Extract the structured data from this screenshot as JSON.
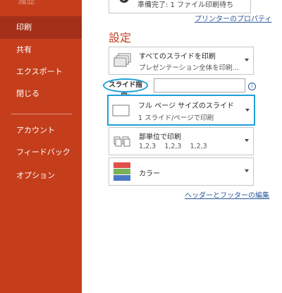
{
  "sidebar": {
    "top_partial": "履歴",
    "items": [
      {
        "label": "印刷"
      },
      {
        "label": "共有"
      },
      {
        "label": "エクスポート"
      },
      {
        "label": "閉じる"
      },
      {
        "label": "アカウント"
      },
      {
        "label": "フィードバック"
      },
      {
        "label": "オプション"
      }
    ]
  },
  "printer": {
    "status": "準備完了: 1 ファイル印刷待ち",
    "properties_link": "プリンターのプロパティ"
  },
  "settings": {
    "title": "設定",
    "print_range": {
      "line1": "すべてのスライドを印刷",
      "line2": "プレゼンテーション全体を印刷..."
    },
    "slides_label": "スライド指定:",
    "slides_value": "",
    "layout": {
      "line1": "フル ページ サイズのスライド",
      "line2": "1 スライド/ページで印刷"
    },
    "collation": {
      "line1": "部単位で印刷",
      "line2": "1,2,3    1,2,3    1,2,3"
    },
    "color": {
      "line1": "カラー"
    },
    "header_footer_link": "ヘッダーとフッターの編集"
  },
  "colors": {
    "brand": "#c43e1c",
    "sidebar_active": "#a5301a",
    "highlight": "#1fa0da",
    "link": "#2b579a"
  }
}
